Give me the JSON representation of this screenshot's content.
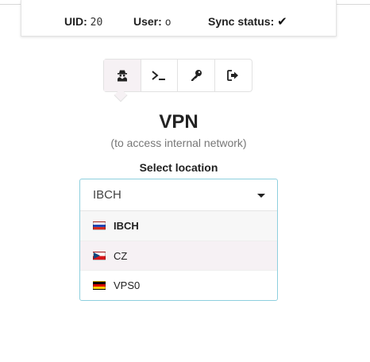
{
  "info": {
    "uid_label": "UID:",
    "uid_value": "20",
    "user_label": "User:",
    "user_value": "o",
    "sync_label": "Sync status:",
    "sync_icon": "check-icon"
  },
  "toolbar": {
    "buttons": [
      {
        "icon": "agent-icon",
        "active": true
      },
      {
        "icon": "terminal-icon",
        "active": false
      },
      {
        "icon": "key-icon",
        "active": false
      },
      {
        "icon": "logout-icon",
        "active": false
      }
    ]
  },
  "vpn": {
    "title": "VPN",
    "subtitle": "(to access internal network)",
    "select_label": "Select location"
  },
  "location_select": {
    "selected": "IBCH",
    "options": [
      {
        "label": "IBCH",
        "flag": "ru-flag-icon",
        "selected": true
      },
      {
        "label": "CZ",
        "flag": "cz-flag-icon",
        "hover": true
      },
      {
        "label": "VPS0",
        "flag": "de-flag-icon"
      }
    ]
  },
  "colors": {
    "active_tab_bg": "#f6f1f4",
    "select_border": "#8ecfde"
  }
}
